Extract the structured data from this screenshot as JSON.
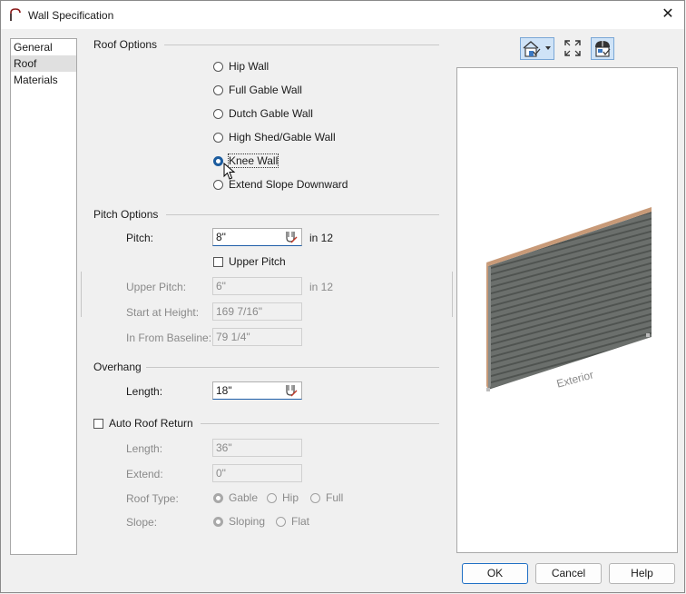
{
  "window": {
    "title": "Wall Specification",
    "close_glyph": "✕"
  },
  "nav": {
    "items": [
      "General",
      "Roof",
      "Materials"
    ],
    "selected": 1
  },
  "roof_options": {
    "heading": "Roof Options",
    "options": [
      "Hip Wall",
      "Full Gable Wall",
      "Dutch Gable Wall",
      "High Shed/Gable Wall",
      "Knee Wall",
      "Extend Slope Downward"
    ],
    "selected": 4
  },
  "pitch_options": {
    "heading": "Pitch Options",
    "pitch_label": "Pitch:",
    "pitch_value": "8\"",
    "pitch_unit": "in 12",
    "upper_pitch_checkbox": "Upper Pitch",
    "upper_pitch_label": "Upper Pitch:",
    "upper_pitch_value": "6\"",
    "upper_pitch_unit": "in 12",
    "start_height_label": "Start at Height:",
    "start_height_value": "169 7/16\"",
    "baseline_label": "In From Baseline:",
    "baseline_value": "79 1/4\""
  },
  "overhang": {
    "heading": "Overhang",
    "length_label": "Length:",
    "length_value": "18\""
  },
  "auto_roof_return": {
    "heading": "Auto Roof Return",
    "length_label": "Length:",
    "length_value": "36\"",
    "extend_label": "Extend:",
    "extend_value": "0\"",
    "roof_type_label": "Roof Type:",
    "roof_type_options": [
      "Gable",
      "Hip",
      "Full"
    ],
    "slope_label": "Slope:",
    "slope_options": [
      "Sloping",
      "Flat"
    ]
  },
  "preview": {
    "label": "Exterior",
    "toolbar_icons": [
      "house-view-icon",
      "fit-view-icon",
      "render-mode-icon"
    ]
  },
  "buttons": {
    "ok": "OK",
    "cancel": "Cancel",
    "help": "Help"
  },
  "colors": {
    "accent": "#1c5c9e",
    "wall": "#6b6f6c",
    "trim": "#c89a78"
  }
}
